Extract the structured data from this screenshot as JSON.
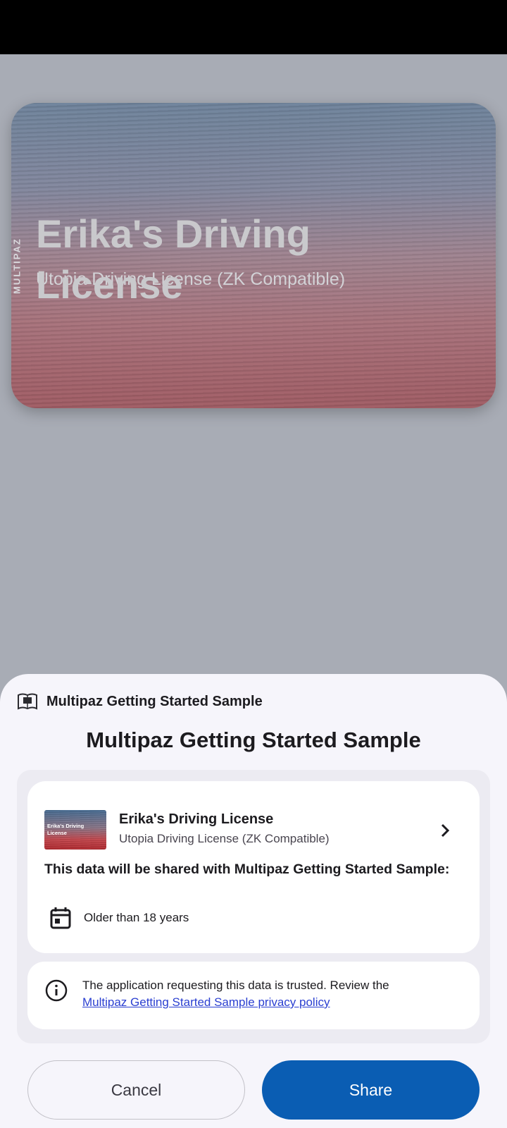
{
  "background_card": {
    "brand": "MULTIPAZ",
    "title": "Erika's Driving License",
    "subtitle": "Utopia Driving License (ZK Compatible)"
  },
  "sheet": {
    "app_name": "Multipaz Getting Started Sample",
    "title": "Multipaz Getting Started Sample",
    "document": {
      "thumb_title": "Erika's Driving License",
      "name": "Erika's Driving License",
      "type": "Utopia Driving License (ZK Compatible)"
    },
    "share_heading": "This data will be shared with Multipaz Getting Started Sample:",
    "claims": [
      {
        "icon": "calendar-icon",
        "label": "Older than 18 years"
      }
    ],
    "trust": {
      "text": "The application requesting this data is trusted. Review the",
      "link": "Multipaz Getting Started Sample privacy policy"
    },
    "buttons": {
      "cancel": "Cancel",
      "share": "Share"
    }
  },
  "colors": {
    "share_button": "#0a5db3",
    "link": "#2a3fd1",
    "sheet_background": "#f6f5fb"
  }
}
